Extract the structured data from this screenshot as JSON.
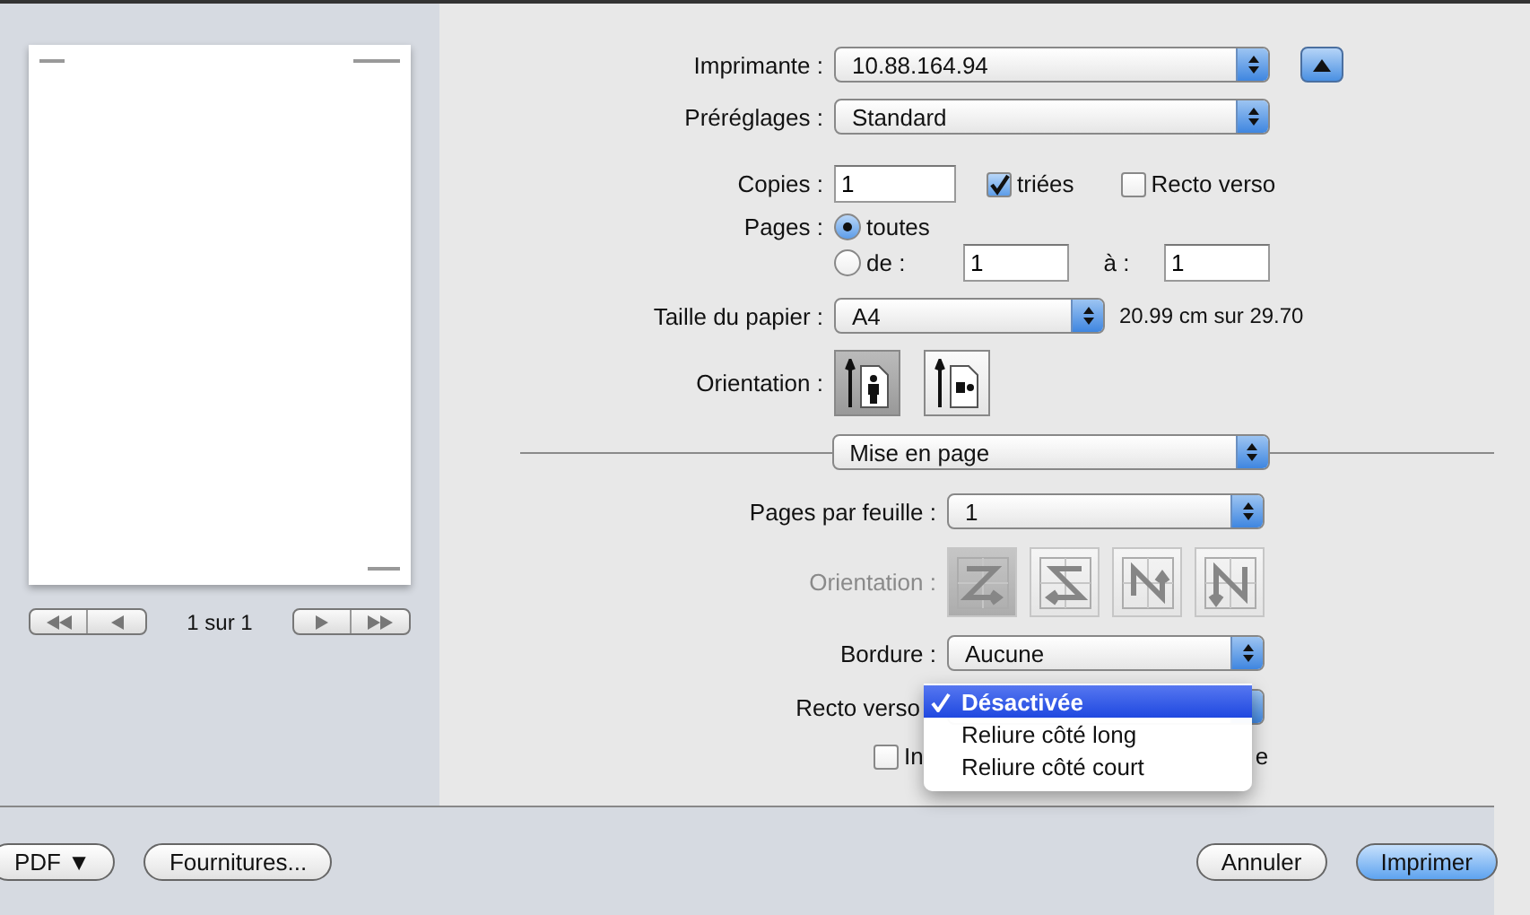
{
  "preview": {
    "page_counter": "1 sur 1"
  },
  "printer": {
    "label": "Imprimante :",
    "value": "10.88.164.94"
  },
  "presets": {
    "label": "Préréglages :",
    "value": "Standard"
  },
  "copies": {
    "label": "Copies :",
    "value": "1",
    "options": [
      {
        "label": "triées",
        "checked": true
      },
      {
        "label": "Recto verso",
        "checked": false
      }
    ]
  },
  "pages": {
    "label": "Pages :",
    "choices": [
      {
        "label": "toutes",
        "selected": true
      },
      {
        "label": "de :",
        "selected": false
      }
    ],
    "from": "1",
    "to_label": "à :",
    "to": "1"
  },
  "paper_size": {
    "label": "Taille du papier :",
    "value": "A4",
    "dimensions": "20.99 cm sur 29.70"
  },
  "orientation": {
    "label": "Orientation :",
    "options": [
      {
        "kind": "portrait",
        "selected": true
      },
      {
        "kind": "landscape",
        "selected": false
      }
    ]
  },
  "section": {
    "value": "Mise en page"
  },
  "layout": {
    "pages_per_sheet": {
      "label": "Pages par feuille :",
      "value": "1"
    },
    "direction": {
      "label": "Orientation :",
      "disabled": true,
      "options": [
        {
          "kind": "z",
          "selected": true
        },
        {
          "kind": "s",
          "selected": false
        },
        {
          "kind": "n-reverse",
          "selected": false
        },
        {
          "kind": "n",
          "selected": false
        }
      ]
    },
    "border": {
      "label": "Bordure :",
      "value": "Aucune"
    },
    "two_sided": {
      "label": "Recto verso",
      "menu": [
        {
          "label": "Désactivée",
          "selected": true
        },
        {
          "label": "Reliure côté long",
          "selected": false
        },
        {
          "label": "Reliure côté court",
          "selected": false
        }
      ]
    },
    "flip": {
      "label": "In",
      "label_tail": "e",
      "checked": false
    }
  },
  "left_buttons": [
    {
      "label": "PDF ▼"
    },
    {
      "label": "Fournitures..."
    }
  ],
  "right_buttons": [
    {
      "label": "Annuler",
      "kind": "plain"
    },
    {
      "label": "Imprimer",
      "kind": "default"
    }
  ]
}
